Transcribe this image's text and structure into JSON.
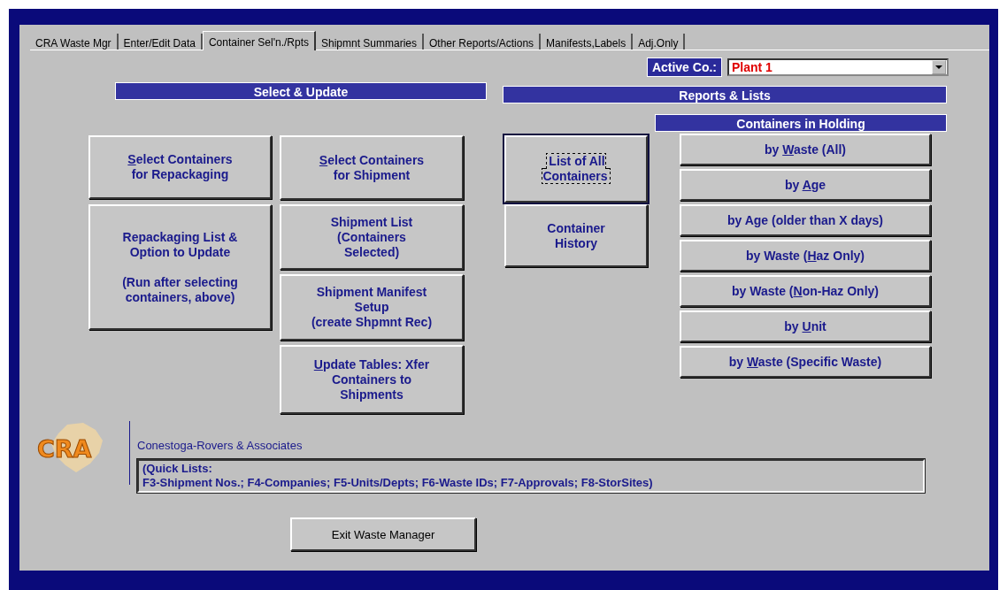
{
  "tabs": [
    {
      "label": "CRA Waste Mgr",
      "selected": false
    },
    {
      "label": "Enter/Edit Data",
      "selected": false
    },
    {
      "label": "Container Sel'n./Rpts",
      "selected": true
    },
    {
      "label": "Shipmnt Summaries",
      "selected": false
    },
    {
      "label": "Other Reports/Actions",
      "selected": false
    },
    {
      "label": "Manifests,Labels",
      "selected": false
    },
    {
      "label": "Adj.Only",
      "selected": false
    }
  ],
  "active_company": {
    "label": "Active Co.:",
    "value": "Plant 1"
  },
  "select_update": {
    "title": "Select & Update",
    "column_1": [
      {
        "parts": [
          {
            "text": "S",
            "underlined": true
          },
          {
            "text": "elect Containers\nfor Repackaging",
            "underlined": false
          }
        ],
        "focused": false
      },
      {
        "parts": [
          {
            "text": "Repackaging List &\nOption to Update\n\n(Run after selecting\ncontainers, above)",
            "underlined": false
          }
        ],
        "focused": false
      }
    ],
    "column_2": [
      {
        "parts": [
          {
            "text": "S",
            "underlined": true
          },
          {
            "text": "elect Containers\nfor Shipment",
            "underlined": false
          }
        ],
        "focused": false
      },
      {
        "parts": [
          {
            "text": "Shipment List\n(Containers\nSelected)",
            "underlined": false
          }
        ],
        "focused": false
      },
      {
        "parts": [
          {
            "text": "Shipment Manifest\nSetup\n(create Shpmnt Rec)",
            "underlined": false
          }
        ],
        "focused": false
      },
      {
        "parts": [
          {
            "text": "U",
            "underlined": true
          },
          {
            "text": "pdate Tables: Xfer\nContainers to\nShipments",
            "underlined": false
          }
        ],
        "focused": false
      }
    ]
  },
  "reports_lists": {
    "title": "Reports & Lists",
    "column_1": [
      {
        "parts": [
          {
            "text": "List of All\nContainers",
            "underlined": false
          }
        ],
        "focused": true
      },
      {
        "parts": [
          {
            "text": "Container\nHistory",
            "underlined": false
          }
        ],
        "focused": false
      }
    ],
    "holding_title": "Containers in Holding",
    "holding": [
      {
        "parts": [
          {
            "text": "by ",
            "underlined": false
          },
          {
            "text": "W",
            "underlined": true
          },
          {
            "text": "aste (All)",
            "underlined": false
          }
        ],
        "focused": false
      },
      {
        "parts": [
          {
            "text": "by ",
            "underlined": false
          },
          {
            "text": "A",
            "underlined": true
          },
          {
            "text": "ge",
            "underlined": false
          }
        ],
        "focused": false
      },
      {
        "parts": [
          {
            "text": "by Age (older than X days)",
            "underlined": false
          }
        ],
        "focused": false
      },
      {
        "parts": [
          {
            "text": "by Waste (",
            "underlined": false
          },
          {
            "text": "H",
            "underlined": true
          },
          {
            "text": "az Only)",
            "underlined": false
          }
        ],
        "focused": false
      },
      {
        "parts": [
          {
            "text": "by Waste (",
            "underlined": false
          },
          {
            "text": "N",
            "underlined": true
          },
          {
            "text": "on-Haz Only)",
            "underlined": false
          }
        ],
        "focused": false
      },
      {
        "parts": [
          {
            "text": "by ",
            "underlined": false
          },
          {
            "text": "U",
            "underlined": true
          },
          {
            "text": "nit",
            "underlined": false
          }
        ],
        "focused": false
      },
      {
        "parts": [
          {
            "text": "by ",
            "underlined": false
          },
          {
            "text": "W",
            "underlined": true
          },
          {
            "text": "aste (Specific Waste)",
            "underlined": false
          }
        ],
        "focused": false
      }
    ]
  },
  "logo": {
    "text": "CRA"
  },
  "company_name": "Conestoga-Rovers & Associates",
  "quick_lists": "(Quick Lists:\nF3-Shipment Nos.; F4-Companies; F5-Units/Depts; F6-Waste IDs; F7-Approvals; F8-StorSites)",
  "exit_button": "Exit Waste Manager"
}
